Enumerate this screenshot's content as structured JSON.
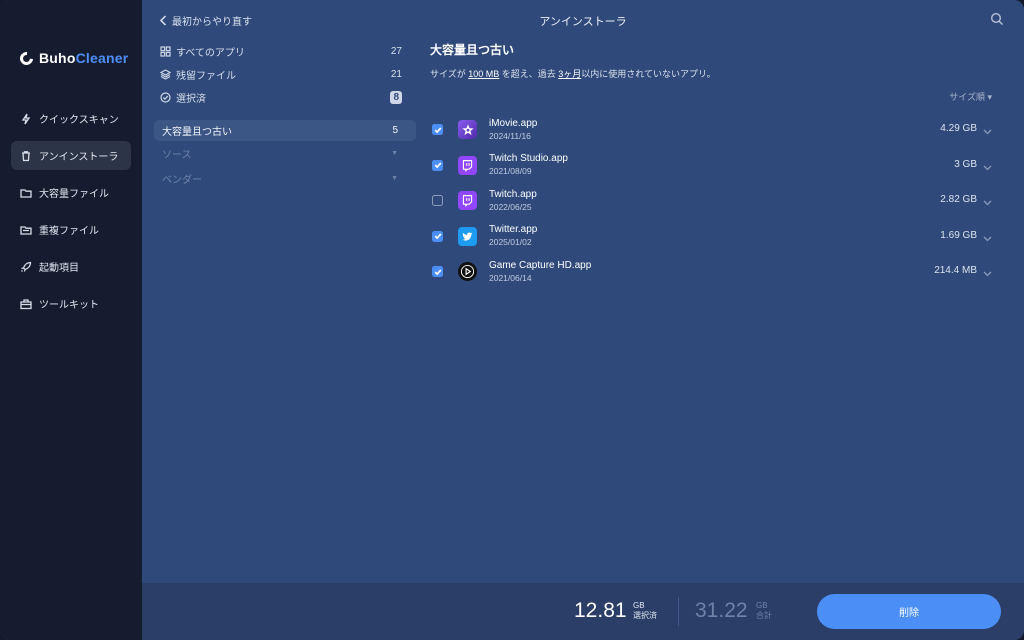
{
  "app": {
    "logo_prefix": "Buho",
    "logo_suffix": "Cleaner",
    "brand_color": "#4d8ef7"
  },
  "sidebar": {
    "items": [
      {
        "label": "クイックスキャン",
        "icon": "lightning-icon",
        "active": false
      },
      {
        "label": "アンインストーラ",
        "icon": "trash-icon",
        "active": true
      },
      {
        "label": "大容量ファイル",
        "icon": "folder-icon",
        "active": false
      },
      {
        "label": "重複ファイル",
        "icon": "duplicate-folder-icon",
        "active": false
      },
      {
        "label": "起動項目",
        "icon": "rocket-icon",
        "active": false
      },
      {
        "label": "ツールキット",
        "icon": "toolkit-icon",
        "active": false
      }
    ]
  },
  "header": {
    "back_label": "最初からやり直す",
    "title": "アンインストーラ"
  },
  "filters": {
    "items": [
      {
        "label": "すべてのアプリ",
        "count": "27",
        "icon": "grid-icon"
      },
      {
        "label": "残留ファイル",
        "count": "21",
        "icon": "layers-icon"
      },
      {
        "label": "選択済",
        "count": "8",
        "icon": "check-circle-icon"
      }
    ],
    "category": {
      "label": "大容量且つ古い",
      "count": "5"
    },
    "dropdowns": [
      {
        "label": "ソース"
      },
      {
        "label": "ベンダー"
      }
    ]
  },
  "list": {
    "title": "大容量且つ古い",
    "desc_pre": "サイズが ",
    "desc_size": "100 MB",
    "desc_mid": " を超え、過去 ",
    "desc_period": "3ヶ月",
    "desc_post": "以内に使用されていないアプリ。",
    "sort_label": "サイズ順 ▾",
    "apps": [
      {
        "name": "iMovie.app",
        "date": "2024/11/16",
        "size": "4.29 GB",
        "checked": true,
        "icon": "imovie-icon",
        "icon_color": "#6d3fd1"
      },
      {
        "name": "Twitch Studio.app",
        "date": "2021/08/09",
        "size": "3 GB",
        "checked": true,
        "icon": "twitch-studio-icon",
        "icon_color": "#9146ff"
      },
      {
        "name": "Twitch.app",
        "date": "2022/06/25",
        "size": "2.82 GB",
        "checked": false,
        "icon": "twitch-icon",
        "icon_color": "#9146ff"
      },
      {
        "name": "Twitter.app",
        "date": "2025/01/02",
        "size": "1.69 GB",
        "checked": true,
        "icon": "twitter-icon",
        "icon_color": "#1d9bf0"
      },
      {
        "name": "Game Capture HD.app",
        "date": "2021/06/14",
        "size": "214.4 MB",
        "checked": true,
        "icon": "game-capture-icon",
        "icon_color": "#111111"
      }
    ]
  },
  "footer": {
    "selected_value": "12.81",
    "selected_unit": "GB",
    "selected_label": "選択済",
    "total_value": "31.22",
    "total_unit": "GB",
    "total_label": "合計",
    "delete_label": "削除"
  }
}
